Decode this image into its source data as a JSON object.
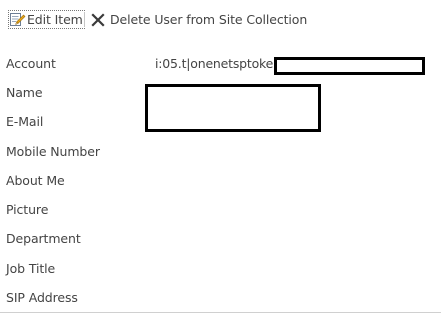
{
  "toolbar": {
    "edit_label": "Edit Item",
    "edit_icon": "edit-pencil-icon",
    "delete_label": "Delete User from Site Collection",
    "delete_icon": "close-x-icon"
  },
  "fields": [
    {
      "label": "Account",
      "value": "i:05.t|onenetsptoken"
    },
    {
      "label": "Name",
      "value": ""
    },
    {
      "label": "E-Mail",
      "value": ""
    },
    {
      "label": "Mobile Number",
      "value": ""
    },
    {
      "label": "About Me",
      "value": ""
    },
    {
      "label": "Picture",
      "value": ""
    },
    {
      "label": "Department",
      "value": ""
    },
    {
      "label": "Job Title",
      "value": ""
    },
    {
      "label": "SIP Address",
      "value": ""
    }
  ],
  "colors": {
    "text": "#444444",
    "redaction_border": "#000000",
    "separator": "#c6c6c6"
  }
}
